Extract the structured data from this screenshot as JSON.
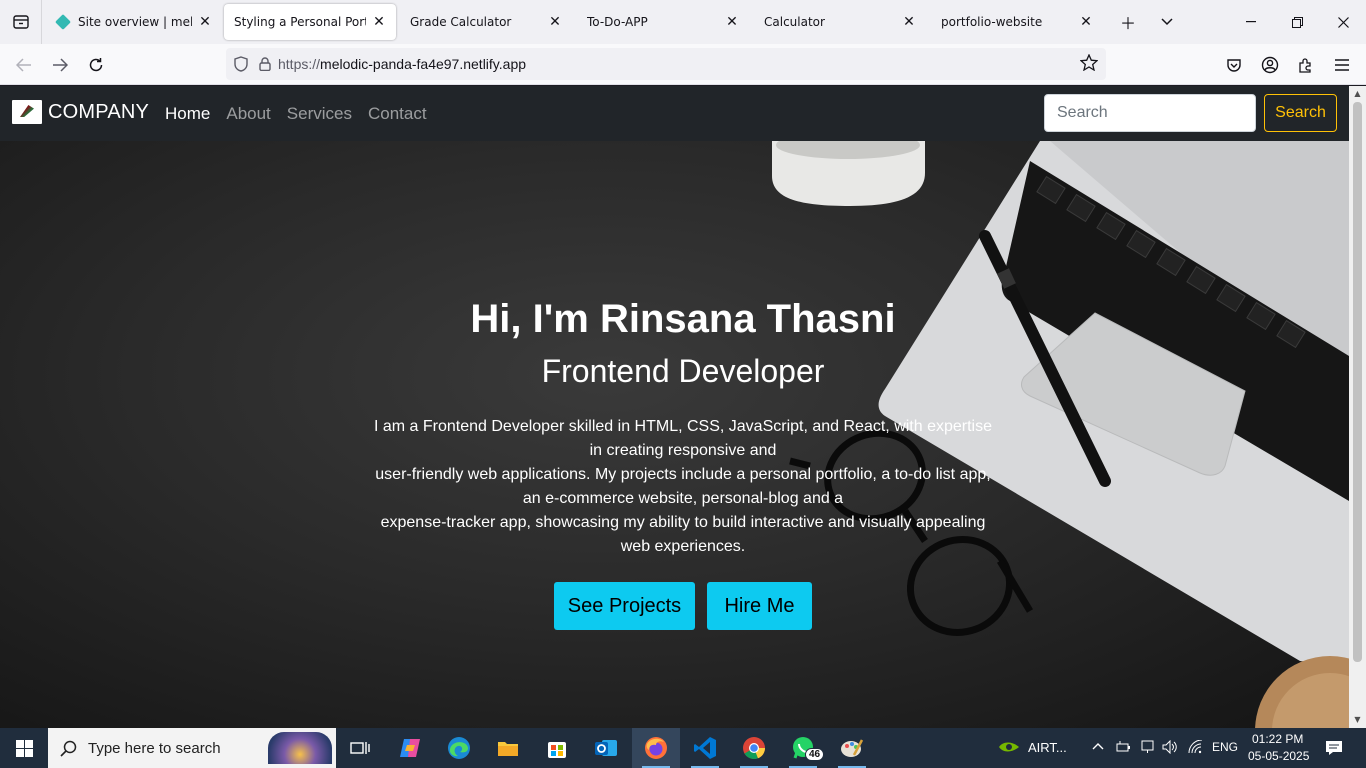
{
  "browser": {
    "tabs": [
      {
        "title": "Site overview | melodic",
        "active": false
      },
      {
        "title": "Styling a Personal Portfolio",
        "active": true
      },
      {
        "title": "Grade Calculator",
        "active": false
      },
      {
        "title": "To-Do-APP",
        "active": false
      },
      {
        "title": "Calculator",
        "active": false
      },
      {
        "title": "portfolio-website",
        "active": false
      }
    ],
    "new_tab_icon": "plus-icon",
    "url_scheme": "https://",
    "url_host": "melodic-panda-fa4e97.netlify.app"
  },
  "site": {
    "brand": "COMPANY",
    "nav": [
      "Home",
      "About",
      "Services",
      "Contact"
    ],
    "search_placeholder": "Search",
    "search_button": "Search",
    "accent_color": "#ffc107",
    "button_color": "#0dcaf0"
  },
  "hero": {
    "title": "Hi, I'm Rinsana Thasni",
    "subtitle": "Frontend Developer",
    "lines": [
      "I am a Frontend Developer skilled in HTML, CSS, JavaScript, and React, with expertise in creating responsive and",
      "user-friendly web applications. My projects include a personal portfolio, a to-do list app, an e-commerce website, personal-blog and a",
      "expense-tracker app, showcasing my ability to build interactive and visually appealing web experiences."
    ],
    "buttons": [
      "See Projects",
      "Hire Me"
    ]
  },
  "taskbar": {
    "search_placeholder": "Type here to search",
    "whatsapp_badge": "46",
    "network_label": "AIRT...",
    "language": "ENG",
    "time": "01:22 PM",
    "date": "05-05-2025"
  }
}
